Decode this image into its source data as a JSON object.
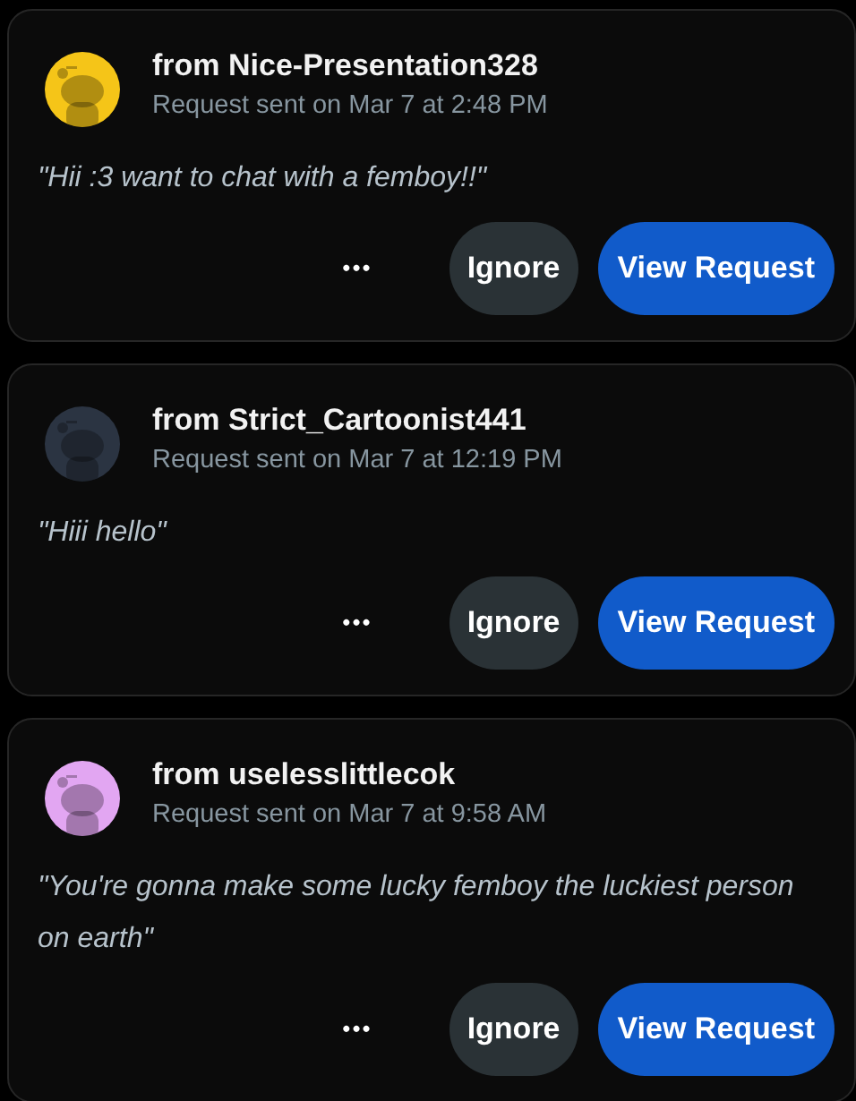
{
  "requests": [
    {
      "from": "from Nice-Presentation328",
      "sent": "Request sent on Mar 7 at 2:48 PM",
      "message": "\"Hii :3 want to chat with a femboy!!\"",
      "color": "#f5c518",
      "more": "•••",
      "ignore": "Ignore",
      "view": "View Request"
    },
    {
      "from": "from Strict_Cartoonist441",
      "sent": "Request sent on Mar 7 at 12:19 PM",
      "message": "\"Hiii hello\"",
      "color": "#2b3442",
      "more": "•••",
      "ignore": "Ignore",
      "view": "View Request"
    },
    {
      "from": "from uselesslittlecok",
      "sent": "Request sent on Mar 7 at 9:58 AM",
      "message": "\"You're gonna make some lucky femboy the luckiest person on earth\"",
      "color": "#e2a6f2",
      "more": "•••",
      "ignore": "Ignore",
      "view": "View Request"
    }
  ]
}
